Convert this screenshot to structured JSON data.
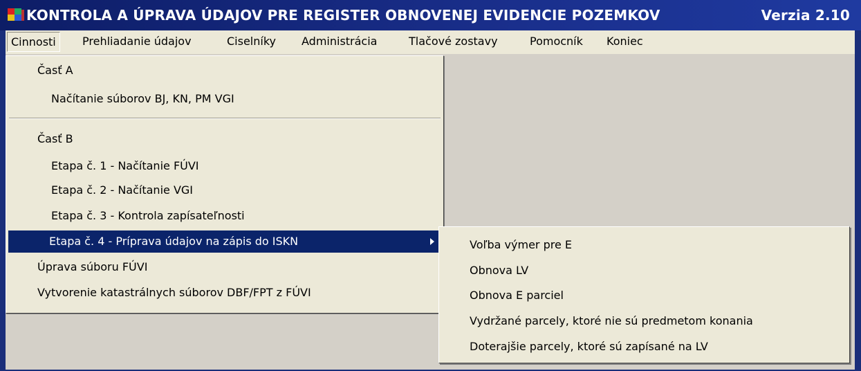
{
  "window": {
    "title": "KONTROLA A ÚPRAVA ÚDAJOV PRE REGISTER OBNOVENEJ EVIDENCIE POZEMKOV",
    "version": "Verzia 2.10"
  },
  "menubar": {
    "items": [
      {
        "label": "Cinnosti"
      },
      {
        "label": "Prehliadanie údajov"
      },
      {
        "label": "Ciselníky"
      },
      {
        "label": "Administrácia"
      },
      {
        "label": "Tlačové zostavy"
      },
      {
        "label": "Pomocník"
      },
      {
        "label": "Koniec"
      }
    ]
  },
  "dropdown": {
    "items": [
      {
        "label": "Časť A"
      },
      {
        "label": "Načítanie súborov BJ, KN, PM VGI"
      },
      {
        "label": "Časť B"
      },
      {
        "label": "Etapa č. 1 - Načítanie FÚVI"
      },
      {
        "label": "Etapa č. 2 - Načítanie VGI"
      },
      {
        "label": "Etapa č. 3 - Kontrola zapísateľnosti"
      },
      {
        "label": "Etapa č. 4 - Príprava  údajov na zápis do ISKN"
      },
      {
        "label": "Úprava súboru FÚVI"
      },
      {
        "label": "Vytvorenie katastrálnych súborov DBF/FPT  z FÚVI"
      }
    ]
  },
  "submenu": {
    "items": [
      {
        "label": "Voľba výmer pre E"
      },
      {
        "label": "Obnova LV"
      },
      {
        "label": "Obnova E parciel"
      },
      {
        "label": "Vydržané parcely, ktoré nie sú predmetom konania"
      },
      {
        "label": "Doterajšie parcely, ktoré sú zapísané na LV"
      }
    ]
  },
  "colors": {
    "titlebar": "#1a2f8c",
    "selection": "#0b246a",
    "menu_bg": "#ece9d8",
    "client_bg": "#d4d0c8"
  },
  "icons": {
    "app": "app-flag-icon",
    "submenu_arrow": "chevron-right-icon"
  }
}
